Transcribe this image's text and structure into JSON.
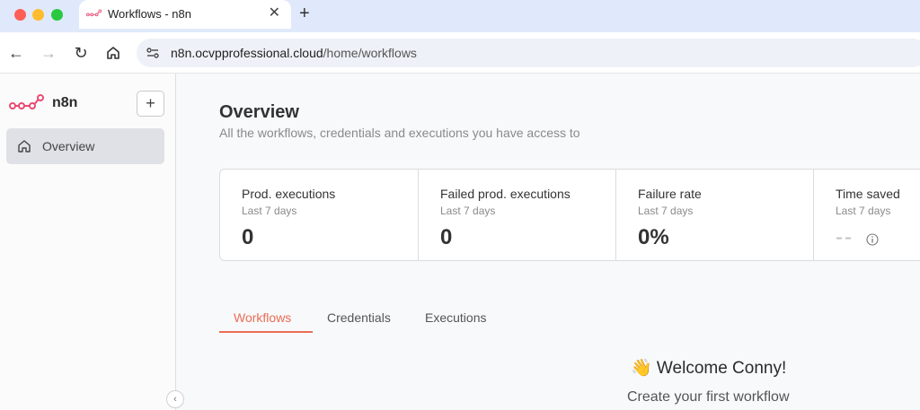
{
  "browser": {
    "tab_title": "Workflows - n8n",
    "tab_close": "✕",
    "new_tab": "+",
    "url_host": "n8n.ocvpprofessional.cloud",
    "url_path": "/home/workflows",
    "back": "←",
    "forward": "→",
    "reload": "↻"
  },
  "sidebar": {
    "logo_text": "n8n",
    "add_label": "+",
    "nav": [
      {
        "label": "Overview",
        "icon": "home-icon"
      }
    ],
    "collapse": "‹"
  },
  "main": {
    "title": "Overview",
    "subtitle": "All the workflows, credentials and executions you have access to",
    "stats": [
      {
        "label": "Prod. executions",
        "period": "Last 7 days",
        "value": "0"
      },
      {
        "label": "Failed prod. executions",
        "period": "Last 7 days",
        "value": "0"
      },
      {
        "label": "Failure rate",
        "period": "Last 7 days",
        "value": "0%"
      },
      {
        "label": "Time saved",
        "period": "Last 7 days",
        "value": "--"
      }
    ],
    "tabs": [
      {
        "label": "Workflows",
        "active": true
      },
      {
        "label": "Credentials",
        "active": false
      },
      {
        "label": "Executions",
        "active": false
      }
    ],
    "welcome": "👋 Welcome Conny!",
    "create_text": "Create your first workflow"
  },
  "colors": {
    "accent": "#ea6d55",
    "brand": "#ea4b71",
    "tabbar": "#dfe9fb"
  }
}
